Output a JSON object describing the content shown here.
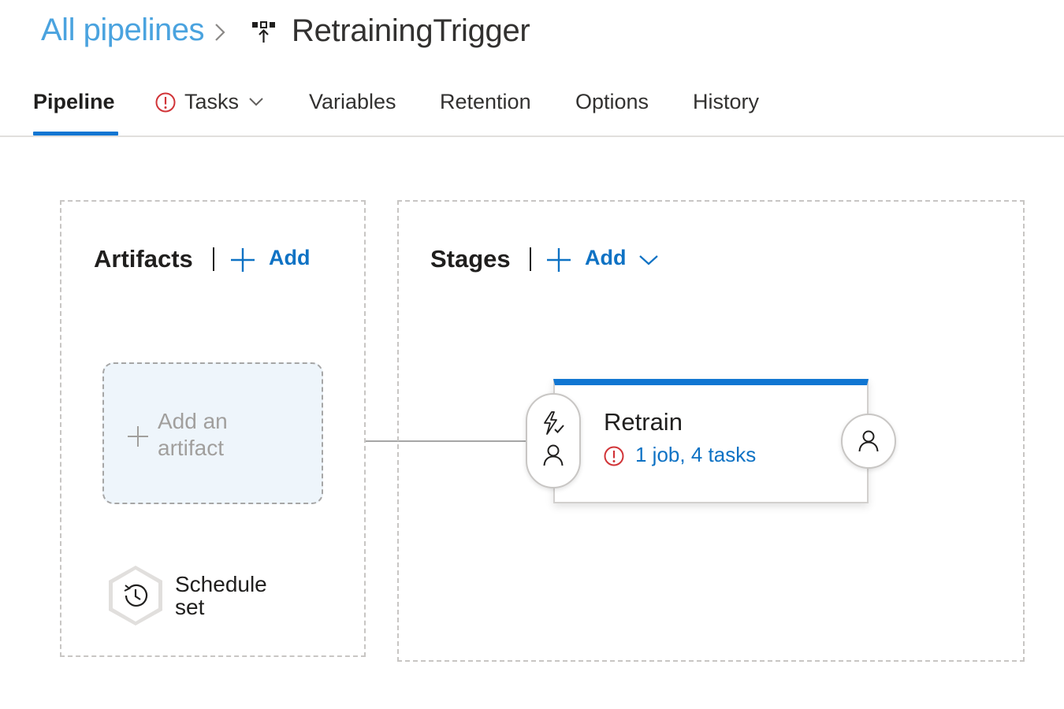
{
  "breadcrumb": {
    "root": "All pipelines",
    "separator_icon": "chevron-right-icon",
    "pipeline_icon": "release-pipeline-icon",
    "title": "RetrainingTrigger"
  },
  "tabs": [
    {
      "label": "Pipeline",
      "active": true
    },
    {
      "label": "Tasks",
      "has_error": true,
      "has_dropdown": true
    },
    {
      "label": "Variables"
    },
    {
      "label": "Retention"
    },
    {
      "label": "Options"
    },
    {
      "label": "History"
    }
  ],
  "artifacts": {
    "heading": "Artifacts",
    "add_label": "Add",
    "placeholder_line1": "Add an",
    "placeholder_line2": "artifact",
    "schedule_line1": "Schedule",
    "schedule_line2": "set"
  },
  "stages": {
    "heading": "Stages",
    "add_label": "Add",
    "stage": {
      "name": "Retrain",
      "tasks_summary": "1 job, 4 tasks"
    }
  },
  "colors": {
    "accent": "#0e72c4",
    "active_tab": "#1076d2",
    "breadcrumb_link": "#4aa3df",
    "error": "#d13438"
  }
}
